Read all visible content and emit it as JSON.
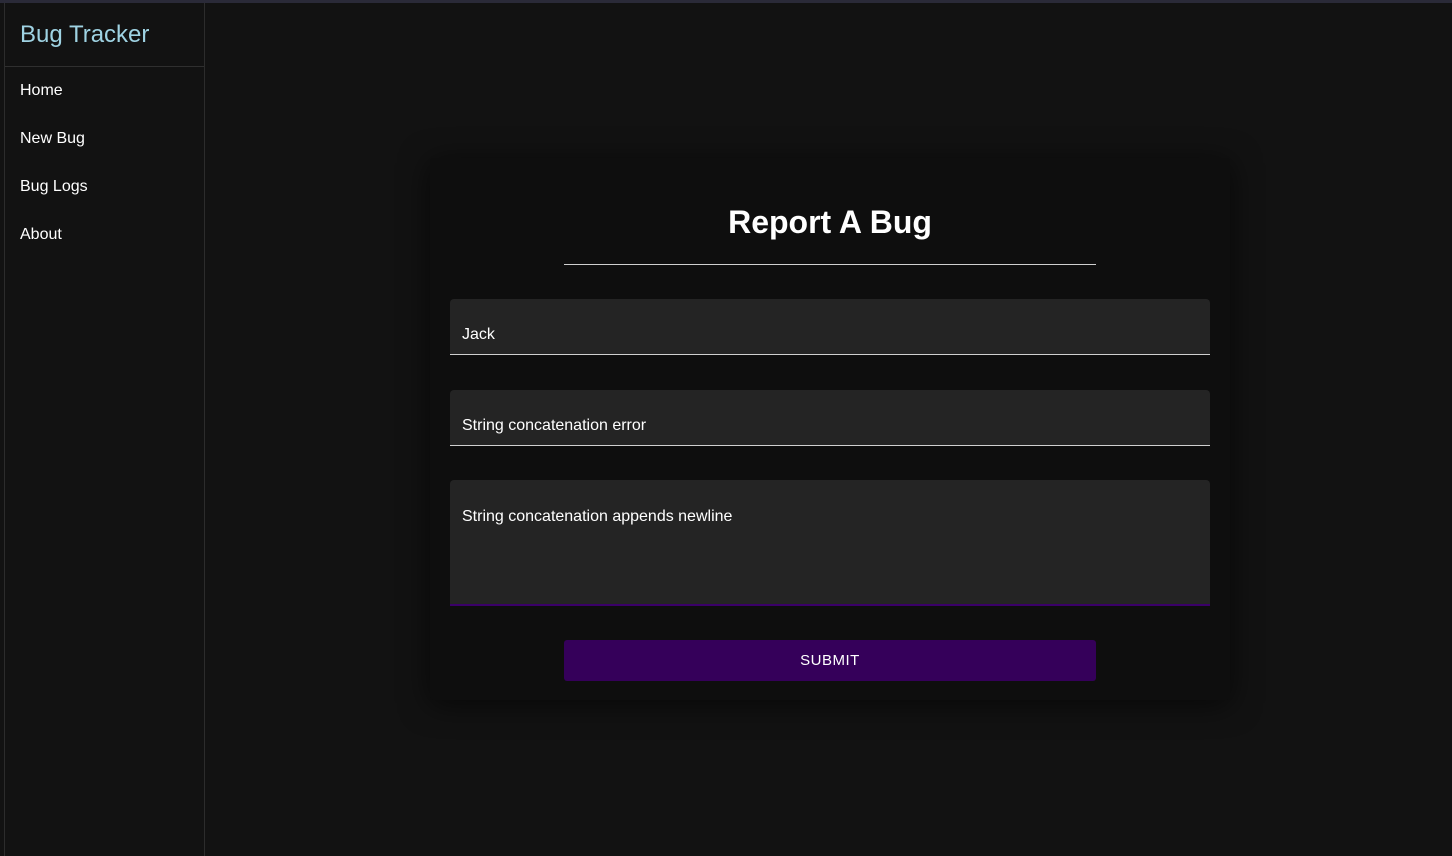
{
  "sidebar": {
    "brand": "Bug Tracker",
    "items": [
      {
        "label": "Home"
      },
      {
        "label": "New Bug"
      },
      {
        "label": "Bug Logs"
      },
      {
        "label": "About"
      }
    ]
  },
  "form": {
    "title": "Report A Bug",
    "name_value": "Jack",
    "title_value": "String concatenation error",
    "description_value": "String concatenation appends newline",
    "submit_label": "SUBMIT"
  },
  "colors": {
    "brand": "#9fd3e3",
    "accent": "#35005a",
    "background": "#121212"
  }
}
